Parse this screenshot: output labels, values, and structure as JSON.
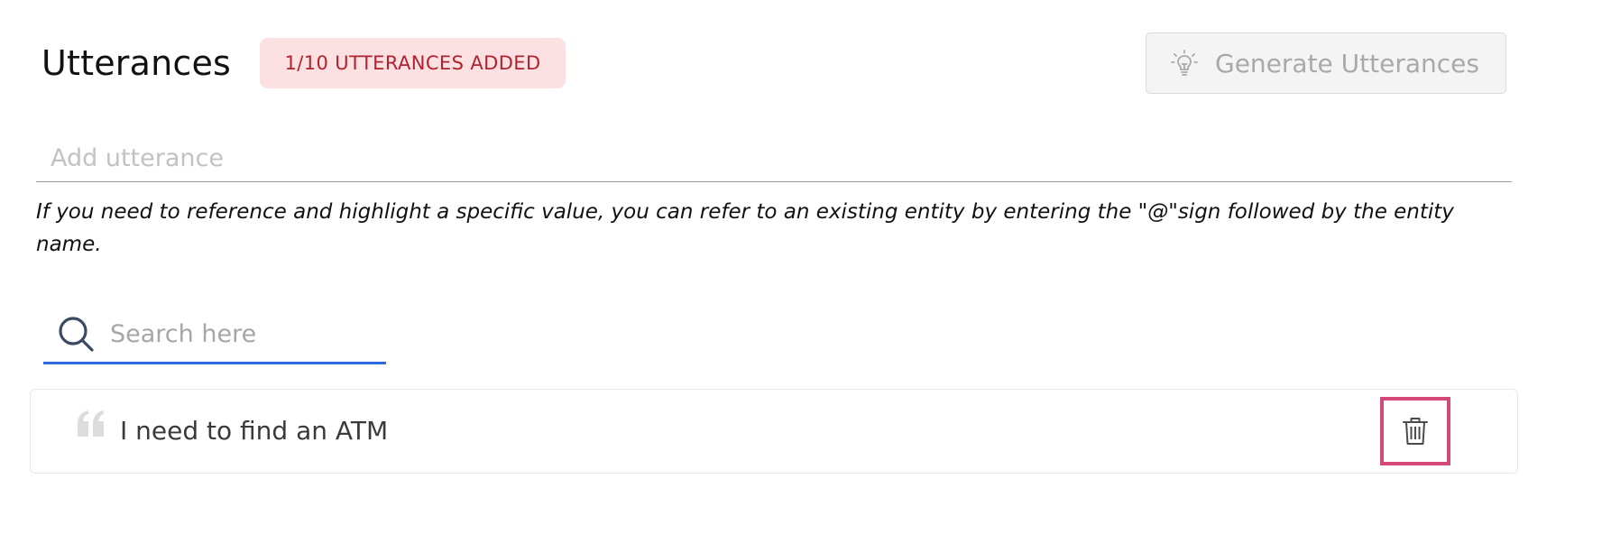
{
  "header": {
    "title": "Utterances",
    "badge": "1/10 UTTERANCES ADDED",
    "generate_button": {
      "label": "Generate Utterances",
      "icon": "lightbulb-icon",
      "state": "disabled"
    }
  },
  "utterance_input": {
    "placeholder": "Add utterance",
    "value": ""
  },
  "hint": "If you need to reference and highlight a specific value, you can refer to an existing entity by entering the \"@\"sign followed by the entity name.",
  "search": {
    "placeholder": "Search here",
    "value": "",
    "icon": "search-icon"
  },
  "utterances": [
    {
      "text": "I need to find an ATM",
      "icon": "quote-icon",
      "action_icon": "trash-icon"
    }
  ],
  "colors": {
    "badge_bg": "#fde1e2",
    "badge_text": "#b0232e",
    "search_underline": "#2d6cdf",
    "delete_highlight": "#d4487a"
  }
}
